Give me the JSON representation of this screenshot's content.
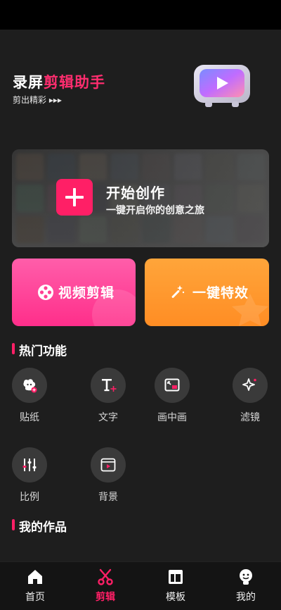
{
  "brand": {
    "title_white": "录屏",
    "title_pink": "剪辑助手",
    "subtitle": "剪出精彩 ▸▸▸"
  },
  "hero": {
    "title": "开始创作",
    "subtitle": "一键开启你的创意之旅"
  },
  "cards": {
    "video_edit": "视频剪辑",
    "one_click_effect": "一键特效"
  },
  "hot_section": {
    "title": "热门功能"
  },
  "features": [
    {
      "label": "贴纸",
      "icon": "sticker-icon"
    },
    {
      "label": "文字",
      "icon": "text-icon"
    },
    {
      "label": "画中画",
      "icon": "picture-in-picture-icon"
    },
    {
      "label": "滤镜",
      "icon": "filter-sparkle-icon"
    },
    {
      "label": "比例",
      "icon": "ratio-sliders-icon"
    },
    {
      "label": "背景",
      "icon": "background-icon"
    }
  ],
  "works_section": {
    "title": "我的作品"
  },
  "tabbar": [
    {
      "label": "首页",
      "icon": "home-icon",
      "active": false
    },
    {
      "label": "剪辑",
      "icon": "scissors-icon",
      "active": true
    },
    {
      "label": "模板",
      "icon": "template-icon",
      "active": false
    },
    {
      "label": "我的",
      "icon": "profile-icon",
      "active": false
    }
  ],
  "colors": {
    "accent": "#ff1f66",
    "background": "#1e1e1e",
    "video_card": "#ff3f93",
    "effect_card": "#ff9a2e"
  }
}
